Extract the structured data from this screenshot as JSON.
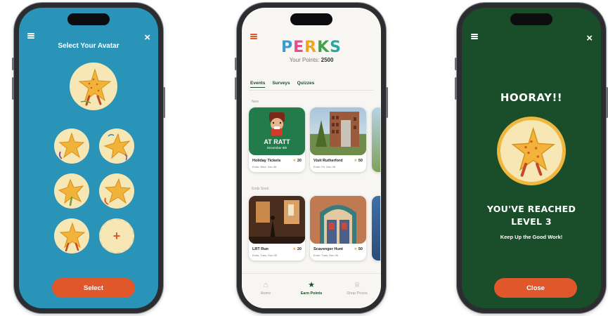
{
  "avatar_screen": {
    "title": "Select Your Avatar",
    "menu_icon": "hamburger-menu-icon",
    "close_icon": "close-icon",
    "add_avatar_icon": "plus-icon",
    "select_button": "Select",
    "colors": {
      "background": "#2a93b8",
      "accent": "#e0572b",
      "avatar_bg": "#f6e7b4"
    }
  },
  "perks_screen": {
    "logo": "PERKS",
    "logo_letters": [
      {
        "char": "P",
        "color": "#3f9ad3"
      },
      {
        "char": "E",
        "color": "#e44f8d"
      },
      {
        "char": "R",
        "color": "#f0a61c"
      },
      {
        "char": "K",
        "color": "#46a24a"
      },
      {
        "char": "S",
        "color": "#29a7a0"
      }
    ],
    "points_label": "Your Points:",
    "points_value": "2500",
    "tabs": [
      {
        "label": "Events",
        "active": true
      },
      {
        "label": "Surveys",
        "active": false
      },
      {
        "label": "Quizzes",
        "active": false
      }
    ],
    "sections": [
      {
        "label": "New",
        "cards": [
          {
            "title": "Holiday Tickets",
            "subtitle": "Ends: Wed, Dec 06",
            "points": "20",
            "poster_line1": "AT RATT",
            "poster_line2": "December 8th"
          },
          {
            "title": "Visit Rutherford",
            "subtitle": "Ends: Fri, Dec 08",
            "points": "50"
          }
        ]
      },
      {
        "label": "Ends Soon",
        "cards": [
          {
            "title": "LRT Run",
            "subtitle": "Ends: Tues, Dec 05",
            "points": "20"
          },
          {
            "title": "Scavenger Hunt",
            "subtitle": "Ends: Tues, Dec 05",
            "points": "50"
          }
        ]
      }
    ],
    "nav": [
      {
        "label": "Home",
        "icon": "home-icon",
        "active": false
      },
      {
        "label": "Earn Points",
        "icon": "star-icon",
        "active": true
      },
      {
        "label": "Shop Prizes",
        "icon": "trophy-icon",
        "active": false
      }
    ],
    "colors": {
      "primary": "#1f4d2c",
      "star": "#f1a91b",
      "menu": "#e0572b"
    }
  },
  "level_screen": {
    "heading": "HOORAY!!",
    "level_line1": "YOU'VE REACHED",
    "level_line2": "LEVEL 3",
    "message": "Keep Up the Good Work!",
    "close_button": "Close",
    "menu_icon": "hamburger-menu-icon",
    "close_icon": "close-icon",
    "colors": {
      "background": "#1a4d2a",
      "accent": "#e0572b"
    }
  }
}
